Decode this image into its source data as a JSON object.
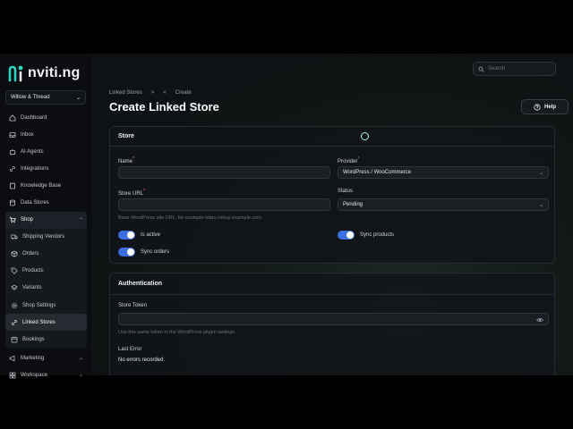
{
  "app": {
    "logo_text": "nviti.ng",
    "workspace": "Willow & Thread"
  },
  "sidebar": {
    "items": [
      {
        "label": "Dashboard",
        "icon": "home-icon"
      },
      {
        "label": "Inbox",
        "icon": "inbox-icon"
      },
      {
        "label": "AI Agents",
        "icon": "bot-icon"
      },
      {
        "label": "Integrations",
        "icon": "link-icon"
      },
      {
        "label": "Knowledge Base",
        "icon": "book-icon"
      },
      {
        "label": "Data Stores",
        "icon": "database-icon"
      }
    ],
    "shop": {
      "label": "Shop",
      "icon": "cart-icon",
      "children": [
        {
          "label": "Shipping Vendors",
          "icon": "truck-icon"
        },
        {
          "label": "Orders",
          "icon": "box-icon"
        },
        {
          "label": "Products",
          "icon": "tag-icon"
        },
        {
          "label": "Variants",
          "icon": "layers-icon"
        },
        {
          "label": "Shop Settings",
          "icon": "gear-icon"
        },
        {
          "label": "Linked Stores",
          "icon": "link-icon",
          "active": true
        },
        {
          "label": "Bookings",
          "icon": "calendar-icon"
        }
      ]
    },
    "bottom": [
      {
        "label": "Marketing",
        "icon": "megaphone-icon"
      },
      {
        "label": "Workspace",
        "icon": "grid-icon"
      }
    ]
  },
  "header": {
    "search_placeholder": "Search",
    "breadcrumb": [
      "Linked Stores",
      "Create"
    ],
    "title": "Create Linked Store",
    "help_label": "Help"
  },
  "store_card": {
    "title": "Store",
    "name_label": "Name",
    "name_value": "",
    "provider_label": "Provider",
    "provider_value": "WordPress / WooCommerce",
    "url_label": "Store URL",
    "url_value": "",
    "url_hint": "Base WordPress site URL, for example https://shop.example.com.",
    "status_label": "Status",
    "status_value": "Pending",
    "is_active_label": "Is active",
    "sync_products_label": "Sync products",
    "sync_orders_label": "Sync orders"
  },
  "auth_card": {
    "title": "Authentication",
    "token_label": "Store Token",
    "token_value": "",
    "token_hint": "Use this same token in the WordPress plugin settings.",
    "last_error_label": "Last Error",
    "last_error_value": "No errors recorded."
  },
  "colors": {
    "accent": "#3b6fe0",
    "logo_teal": "#2dd4bf"
  }
}
